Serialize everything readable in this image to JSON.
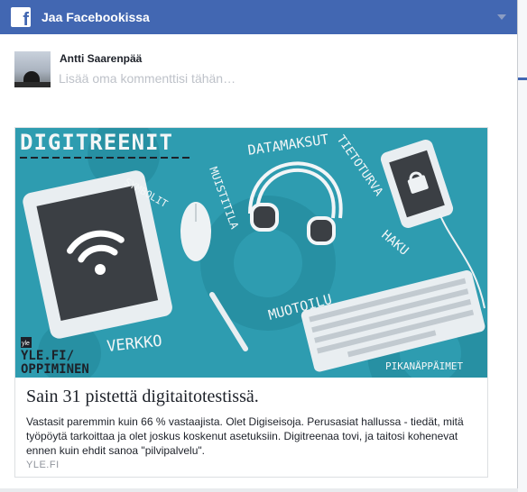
{
  "dialog": {
    "title": "Jaa Facebookissa",
    "logo_icon": "facebook-icon",
    "menu_icon": "chevron-down-icon"
  },
  "composer": {
    "user_name": "Antti Saarenpää",
    "placeholder": "Lisää oma kommenttisi tähän…"
  },
  "card": {
    "image_labels": {
      "heading": "DIGITREENIT",
      "datamaksut": "DATAMAKSUT",
      "tietoturva": "TIETOTURVA",
      "symbolit": "SYMBOLIT",
      "muistitila": "MUISTITILA",
      "haku": "HAKU",
      "muotoilu": "MUOTOILU",
      "verkko": "VERKKO",
      "pikanappaimet": "PIKANÄPPÄIMET",
      "yle_logo": "yle",
      "yle_url_1": "YLE.FI/",
      "yle_url_2": "OPPIMINEN"
    },
    "title": "Sain 31 pistettä digitaitotestissä.",
    "description": "Vastasit paremmin kuin 66 % vastaajista. Olet Digiseisoja. Perusasiat hallussa - tiedät, mitä työpöytä tarkoittaa ja olet joskus koskenut asetuksiin. Digitreenaa tovi, ja taitosi kohenevat ennen kuin ehdit sanoa \"pilvipalvelu\".",
    "domain": "YLE.FI"
  }
}
